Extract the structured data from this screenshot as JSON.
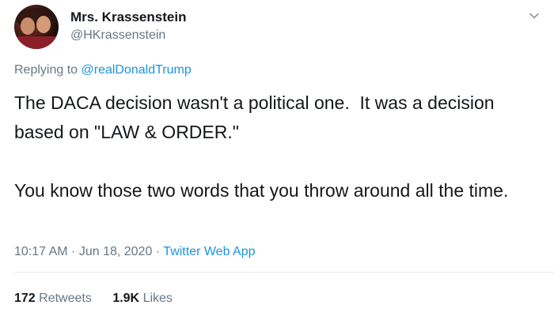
{
  "author": {
    "display_name": "Mrs. Krassenstein",
    "handle": "@HKrassenstein"
  },
  "reply": {
    "prefix": "Replying to ",
    "mention": "@realDonaldTrump"
  },
  "tweet": {
    "paragraphs": [
      "The DACA decision wasn't a political one.  It was a decision based on \"LAW & ORDER.\"",
      "You know those two words that you throw around all the time."
    ]
  },
  "meta": {
    "time": "10:17 AM",
    "sep1": " · ",
    "date": "Jun 18, 2020",
    "sep2": " · ",
    "source": "Twitter Web App"
  },
  "stats": {
    "retweets_count": "172",
    "retweets_label": "Retweets",
    "likes_count": "1.9K",
    "likes_label": "Likes"
  },
  "colors": {
    "link": "#1b95e0",
    "secondary_text": "#657786",
    "primary_text": "#14171a"
  },
  "icons": {
    "menu": "chevron-down-icon"
  }
}
